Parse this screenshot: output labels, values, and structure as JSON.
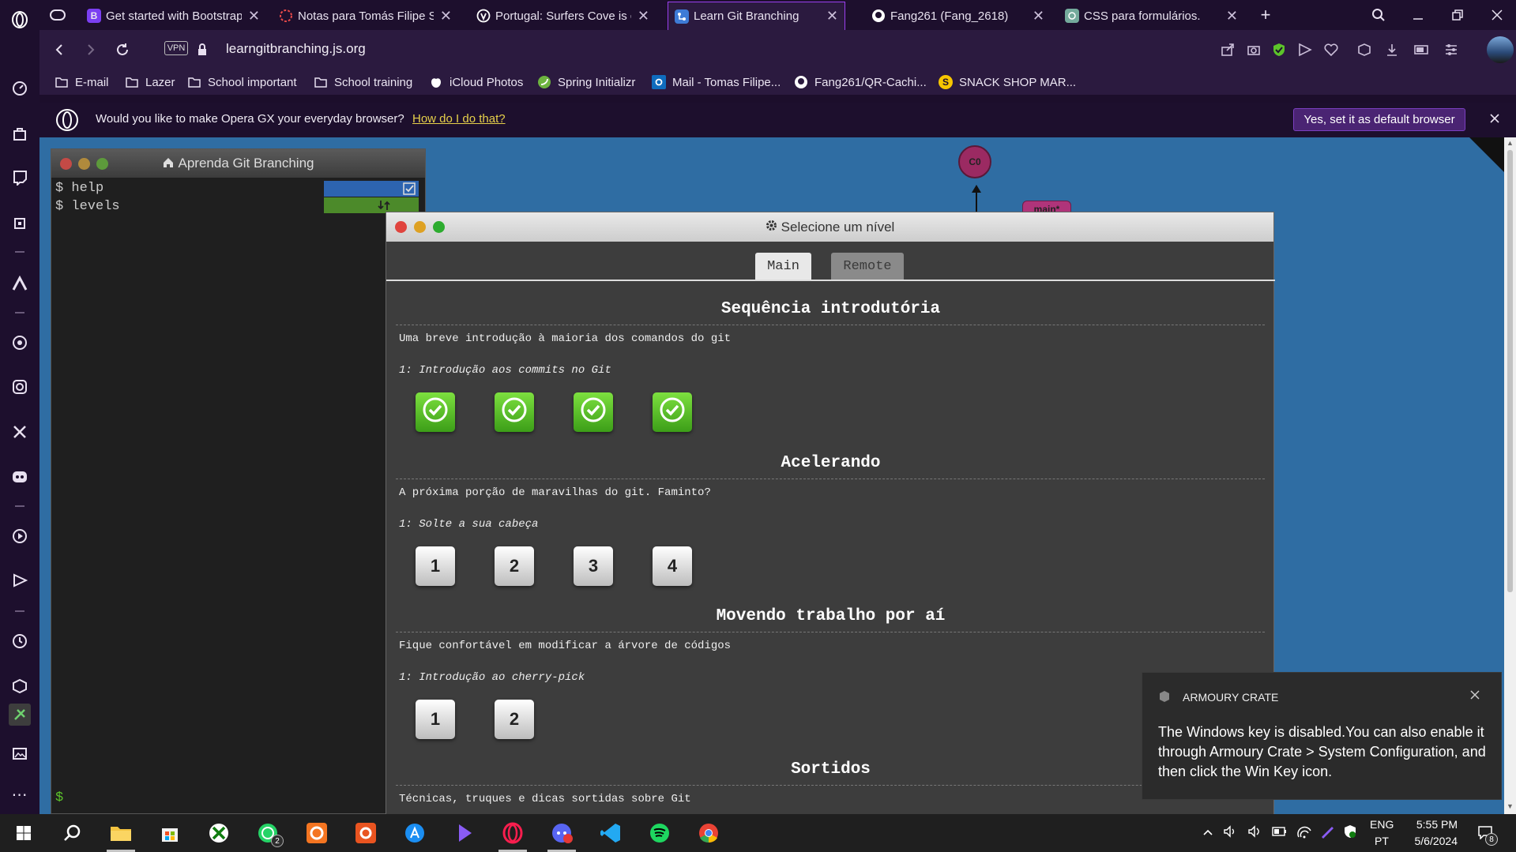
{
  "tabs": [
    {
      "title": "Get started with Bootstrap",
      "favicon_color": "#7b3ff2",
      "favicon_glyph": "B",
      "icon": "bootstrap-icon"
    },
    {
      "title": "Notas para Tomás Filipe Sa",
      "favicon_color": "#e84a4a",
      "favicon_glyph": "",
      "icon": "spinner-icon"
    },
    {
      "title": "Portugal: Surfers Cove is cc",
      "favicon_color": "#ffffff",
      "favicon_glyph": "",
      "icon": "shield-icon"
    },
    {
      "title": "Learn Git Branching",
      "favicon_color": "#3e7bd6",
      "favicon_glyph": "",
      "icon": "git-icon"
    },
    {
      "title": "Fang261 (Fang_2618)",
      "favicon_color": "#ffffff",
      "favicon_glyph": "",
      "icon": "github-icon"
    },
    {
      "title": "CSS para formulários.",
      "favicon_color": "#74aa9c",
      "favicon_glyph": "",
      "icon": "chatgpt-icon"
    }
  ],
  "address": {
    "vpn_label": "VPN",
    "url": "learngitbranching.js.org"
  },
  "bookmarks": [
    {
      "label": "E-mail",
      "icon": "folder-icon"
    },
    {
      "label": "Lazer",
      "icon": "folder-icon"
    },
    {
      "label": "School important",
      "icon": "folder-icon"
    },
    {
      "label": "School training",
      "icon": "folder-icon"
    },
    {
      "label": "iCloud Photos",
      "icon": "apple-icon"
    },
    {
      "label": "Spring Initializr",
      "icon": "spring-icon"
    },
    {
      "label": "Mail - Tomas Filipe...",
      "icon": "outlook-icon"
    },
    {
      "label": "Fang261/QR-Cachi...",
      "icon": "github-icon"
    },
    {
      "label": "SNACK SHOP MAR...",
      "icon": "snack-icon"
    }
  ],
  "infobar": {
    "message": "Would you like to make Opera GX your everyday browser?",
    "link": "How do I do that?",
    "button": "Yes, set it as default browser"
  },
  "terminal": {
    "title": "Aprenda Git Branching",
    "lines": [
      "$ help",
      "$ levels"
    ],
    "prompt": "$"
  },
  "graph": {
    "node": "C0",
    "branch": "main*"
  },
  "modal": {
    "title": "Selecione um nível",
    "tab_main": "Main",
    "tab_remote": "Remote",
    "sections": [
      {
        "title": "Sequência introdutória",
        "desc": "Uma breve introdução à maioria dos comandos do git",
        "sub": "1: Introdução aos commits no Git",
        "levels": [
          "done",
          "done",
          "done",
          "done"
        ]
      },
      {
        "title": "Acelerando",
        "desc": "A próxima porção de maravilhas do git. Faminto?",
        "sub": "1: Solte a sua cabeça",
        "levels": [
          "1",
          "2",
          "3",
          "4"
        ]
      },
      {
        "title": "Movendo trabalho por aí",
        "desc": "Fique confortável em modificar a árvore de códigos",
        "sub": "1: Introdução ao cherry-pick",
        "levels": [
          "1",
          "2"
        ]
      },
      {
        "title": "Sortidos",
        "desc": "Técnicas, truques e dicas sortidas sobre Git"
      }
    ]
  },
  "toast": {
    "app": "ARMOURY CRATE",
    "message": "The Windows key is disabled.You can also enable it through Armoury Crate > System Configuration, and then click the Win Key icon."
  },
  "taskbar": {
    "lang_top": "ENG",
    "lang_bottom": "PT",
    "time": "5:55 PM",
    "date": "5/6/2024",
    "whatsapp_badge": "2",
    "notif_count": "8"
  },
  "colors": {
    "accent": "#9b3ff0",
    "page_bg": "#2f6da3",
    "level_done": "#5cc42a"
  }
}
